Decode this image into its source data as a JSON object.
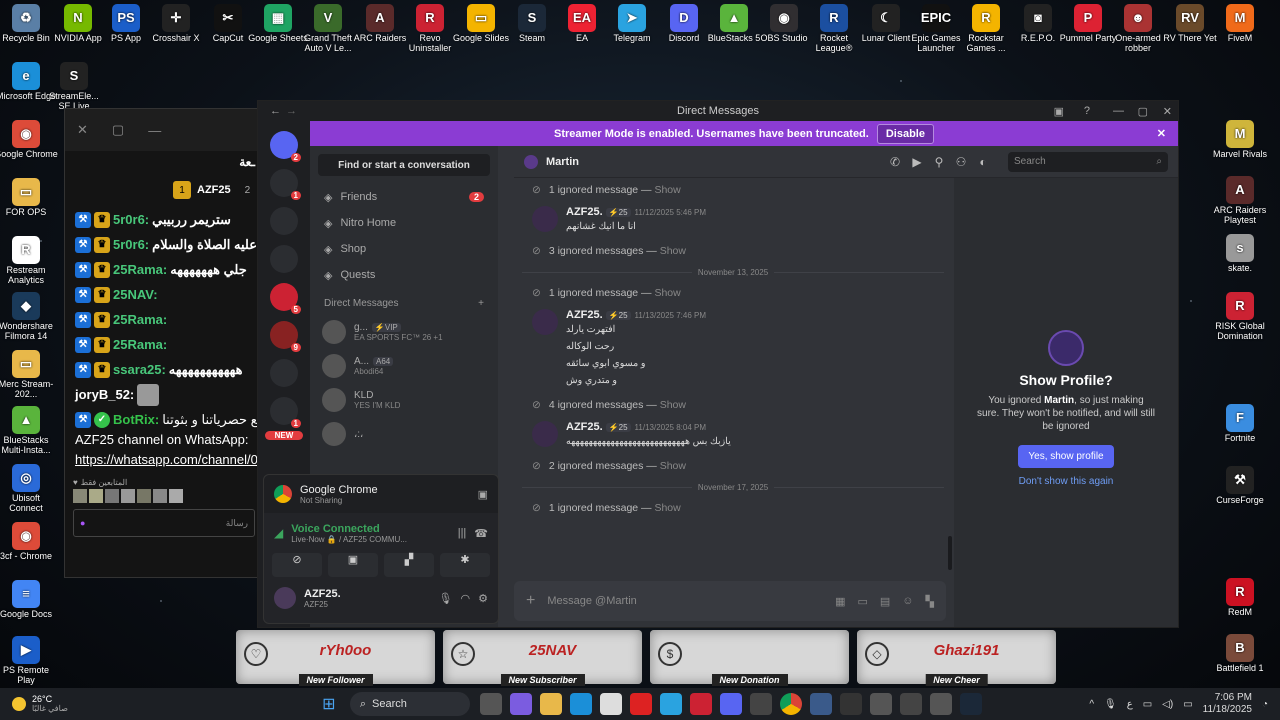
{
  "desktop_left": [
    {
      "label": "Recycle Bin",
      "icon": "recycle-bin-icon",
      "color": "#5a7fa6",
      "glyph": "♻"
    },
    {
      "label": "Microsoft Edge",
      "icon": "edge-icon",
      "color": "#1b8fd8",
      "glyph": "e"
    },
    {
      "label": "Google Chrome",
      "icon": "chrome-icon",
      "color": "#dd4b39",
      "glyph": "◉"
    },
    {
      "label": "FOR OPS",
      "icon": "folder-icon",
      "color": "#e8b84a",
      "glyph": "▭"
    },
    {
      "label": "Restream Analytics",
      "icon": "restream-icon",
      "color": "#fff",
      "glyph": "R"
    },
    {
      "label": "Wondershare Filmora 14",
      "icon": "filmora-icon",
      "color": "#1a3a5a",
      "glyph": "◆"
    },
    {
      "label": "Merc Stream-202...",
      "icon": "folder-icon",
      "color": "#e8b84a",
      "glyph": "▭"
    },
    {
      "label": "BlueStacks Multi-Insta...",
      "icon": "bluestacks-icon",
      "color": "#5ab43c",
      "glyph": "▲"
    },
    {
      "label": "Ubisoft Connect",
      "icon": "ubisoft-icon",
      "color": "#2a6ad8",
      "glyph": "◎"
    },
    {
      "label": "3cf - Chrome",
      "icon": "chrome-icon",
      "color": "#dd4b39",
      "glyph": "◉"
    },
    {
      "label": "Google Docs",
      "icon": "docs-icon",
      "color": "#4285f4",
      "glyph": "≡"
    },
    {
      "label": "PS Remote Play",
      "icon": "ps-remote-icon",
      "color": "#1b5ec9",
      "glyph": "▶"
    }
  ],
  "desktop_top": [
    {
      "label": "NVIDIA App",
      "color": "#76b900",
      "glyph": "N"
    },
    {
      "label": "PS App",
      "color": "#1b5ec9",
      "glyph": "PS"
    },
    {
      "label": "Crosshair X",
      "color": "#222",
      "glyph": "✛"
    },
    {
      "label": "CapCut",
      "color": "#111",
      "glyph": "✂"
    },
    {
      "label": "Google Sheets",
      "color": "#1fa463",
      "glyph": "▦"
    },
    {
      "label": "Grand Theft Auto V Le...",
      "color": "#3a6a2a",
      "glyph": "V"
    },
    {
      "label": "ARC Raiders",
      "color": "#5a2a2a",
      "glyph": "A"
    },
    {
      "label": "Revo Uninstaller",
      "color": "#c23",
      "glyph": "R"
    },
    {
      "label": "Google Slides",
      "color": "#f4b400",
      "glyph": "▭"
    },
    {
      "label": "Steam",
      "color": "#1b2838",
      "glyph": "S"
    },
    {
      "label": "EA",
      "color": "#e23",
      "glyph": "EA"
    },
    {
      "label": "Telegram",
      "color": "#2aa3e0",
      "glyph": "➤"
    },
    {
      "label": "Discord",
      "color": "#5865f2",
      "glyph": "D"
    },
    {
      "label": "BlueStacks 5",
      "color": "#5ab43c",
      "glyph": "▲"
    },
    {
      "label": "OBS Studio",
      "color": "#302e31",
      "glyph": "◉"
    },
    {
      "label": "Rocket League®",
      "color": "#1b4fa0",
      "glyph": "R"
    },
    {
      "label": "Lunar Client",
      "color": "#222",
      "glyph": "☾"
    },
    {
      "label": "Epic Games Launcher",
      "color": "#111",
      "glyph": "EPIC"
    },
    {
      "label": "Rockstar Games ...",
      "color": "#f4b400",
      "glyph": "R"
    },
    {
      "label": "R.E.P.O.",
      "color": "#222",
      "glyph": "◙"
    },
    {
      "label": "Pummel Party",
      "color": "#d23",
      "glyph": "P"
    },
    {
      "label": "One-armed robber",
      "color": "#a33",
      "glyph": "☻"
    },
    {
      "label": "RV There Yet",
      "color": "#6a4a2a",
      "glyph": "RV"
    },
    {
      "label": "FiveM",
      "color": "#f06a1a",
      "glyph": "M"
    }
  ],
  "desktop_second_row": [
    {
      "label": "StreamEle... SE.Live",
      "color": "#222",
      "glyph": "S"
    }
  ],
  "desktop_right": [
    {
      "label": "Marvel Rivals",
      "color": "#cfb53b",
      "glyph": "M"
    },
    {
      "label": "ARC Raiders Playtest",
      "color": "#5a2a2a",
      "glyph": "A"
    },
    {
      "label": "skate.",
      "color": "#999",
      "glyph": "s"
    },
    {
      "label": "RISK Global Domination",
      "color": "#c23",
      "glyph": "R"
    },
    {
      "label": "Fortnite",
      "color": "#3a8de0",
      "glyph": "F"
    },
    {
      "label": "CurseForge",
      "color": "#222",
      "glyph": "⚒"
    },
    {
      "label": "RedM",
      "color": "#c12",
      "glyph": "R"
    },
    {
      "label": "Battlefield 1",
      "color": "#7a4a3a",
      "glyph": "B"
    }
  ],
  "chat": {
    "header_title": "ـعة",
    "streamer": "AZF25",
    "streamer_sub": "1",
    "viewers": "2",
    "lines": [
      {
        "user": "5r0r6:",
        "text": "ستريمر رربيبي"
      },
      {
        "user": "5r0r6:",
        "text": "عليه الصلاة والسلام"
      },
      {
        "user": "25Rama:",
        "text": "جلي هههههههه"
      },
      {
        "user": "25NAV:",
        "text": ""
      },
      {
        "user": "25Rama:",
        "text": ""
      },
      {
        "user": "25Rama:",
        "text": ""
      },
      {
        "user": "ssara25:",
        "text": "هههههههههههه"
      }
    ],
    "joryb": "joryB_52:",
    "botrix": "BotRix:",
    "botrix_text": "جميع حصرياتنا و بثوتنا",
    "whatsapp_line": "AZF25 channel on WhatsApp:",
    "whatsapp_link": "https://whatsapp.com/channel/0",
    "emote_label": "المتابعين فقط",
    "input_placeholder": "رسالة"
  },
  "discord": {
    "window_title": "Direct Messages",
    "banner_text": "Streamer Mode is enabled. Usernames have been truncated.",
    "banner_button": "Disable",
    "find": "Find or start a conversation",
    "nav": [
      {
        "label": "Friends",
        "badge": "2"
      },
      {
        "label": "Nitro Home",
        "badge": ""
      },
      {
        "label": "Shop",
        "badge": ""
      },
      {
        "label": "Quests",
        "badge": ""
      }
    ],
    "dm_header": "Direct Messages",
    "dms": [
      {
        "name": "g...",
        "tag": "⚡VIP",
        "sub": "EA SPORTS FC™ 26 +1"
      },
      {
        "name": "A...",
        "tag": "A64",
        "sub": "Abodi64"
      },
      {
        "name": "KLD",
        "tag": "",
        "sub": "YES I'M KLD"
      },
      {
        "name": "،:،",
        "tag": "",
        "sub": ""
      }
    ],
    "guild_badges": [
      "2",
      "1",
      "1",
      "5",
      "9",
      "1",
      "1"
    ],
    "new_label": "NEW",
    "panel": {
      "app": "Google Chrome",
      "app_sub": "Not Sharing",
      "voice": "Voice Connected",
      "voice_sub": "Live·Now 🔒 / AZF25 COMMU...",
      "user": "AZF25.",
      "user_sub": "AZF25"
    },
    "chat_name": "Martin",
    "search": "Search",
    "messages": [
      {
        "kind": "ignored",
        "text": "1 ignored message — ",
        "show": "Show"
      },
      {
        "kind": "msg",
        "name": "AZF25.",
        "tag": "⚡25",
        "time": "11/12/2025 5:46 PM",
        "lines": [
          "انا ما انيك غشانهم"
        ]
      },
      {
        "kind": "ignored",
        "text": "3 ignored messages — ",
        "show": "Show"
      },
      {
        "kind": "divider",
        "text": "November 13, 2025"
      },
      {
        "kind": "ignored",
        "text": "1 ignored message — ",
        "show": "Show"
      },
      {
        "kind": "msg",
        "name": "AZF25.",
        "tag": "⚡25",
        "time": "11/13/2025 7:46 PM",
        "lines": [
          "افتهرت يارلد",
          "رحت الوكاله",
          "و مسوي ابوي سائقه",
          "و متدري وش"
        ],
        "hover_time": "7:46 PM"
      },
      {
        "kind": "ignored",
        "text": "4 ignored messages — ",
        "show": "Show"
      },
      {
        "kind": "msg",
        "name": "AZF25.",
        "tag": "⚡25",
        "time": "11/13/2025 8:04 PM",
        "lines": [
          "يازبك بس هههههههههههههههههههههههههههه"
        ]
      },
      {
        "kind": "ignored",
        "text": "2 ignored messages — ",
        "show": "Show"
      },
      {
        "kind": "divider",
        "text": "November 17, 2025"
      },
      {
        "kind": "ignored",
        "text": "1 ignored message — ",
        "show": "Show"
      }
    ],
    "composer": "Message @Martin",
    "profile": {
      "title": "Show Profile?",
      "desc_a": "You ignored ",
      "desc_name": "Martin",
      "desc_b": ", so just making sure. They won't be notified, and will still be ignored",
      "yes": "Yes, show profile",
      "no": "Don't show this again"
    }
  },
  "alerts": [
    {
      "name": "rYh0oo",
      "label": "New Follower",
      "icon": "heart-icon",
      "glyph": "♡"
    },
    {
      "name": "25NAV",
      "label": "New Subscriber",
      "icon": "star-icon",
      "glyph": "☆"
    },
    {
      "name": "",
      "label": "New Donation",
      "icon": "dollar-icon",
      "glyph": "$"
    },
    {
      "name": "Ghazi191",
      "label": "New Cheer",
      "icon": "diamond-icon",
      "glyph": "◇"
    }
  ],
  "taskbar": {
    "weather_temp": "26°C",
    "weather_desc": "صافي غالبًا",
    "search": "Search",
    "time": "7:06 PM",
    "date": "11/18/2025",
    "lang": "ع"
  }
}
